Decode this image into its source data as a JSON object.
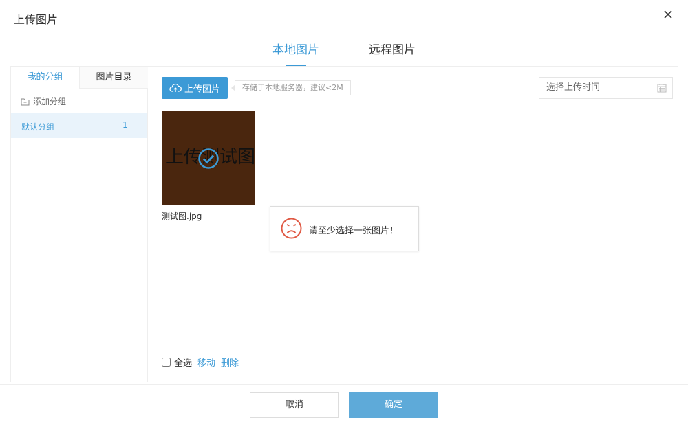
{
  "dialog": {
    "title": "上传图片"
  },
  "tabs": {
    "local": "本地图片",
    "remote": "远程图片"
  },
  "sidebar": {
    "tab_groups": "我的分组",
    "tab_directory": "图片目录",
    "add_group": "添加分组",
    "groups": [
      {
        "name": "默认分组",
        "count": "1"
      }
    ]
  },
  "toolbar": {
    "upload_label": "上传图片",
    "hint": "存储于本地服务器，建议<2M",
    "date_placeholder": "选择上传时间"
  },
  "images": [
    {
      "thumb_text": "上传测试图",
      "filename": "测试图.jpg",
      "selected": true,
      "bg_color": "#4a260e"
    }
  ],
  "toast": {
    "message": "请至少选择一张图片！",
    "icon": "sad-face-icon",
    "color": "#e05a45"
  },
  "bottom": {
    "select_all": "全选",
    "move": "移动",
    "delete": "删除"
  },
  "footer": {
    "cancel": "取消",
    "confirm": "确定"
  },
  "colors": {
    "accent": "#3c9ad6",
    "confirm_button": "#5eaad9"
  }
}
